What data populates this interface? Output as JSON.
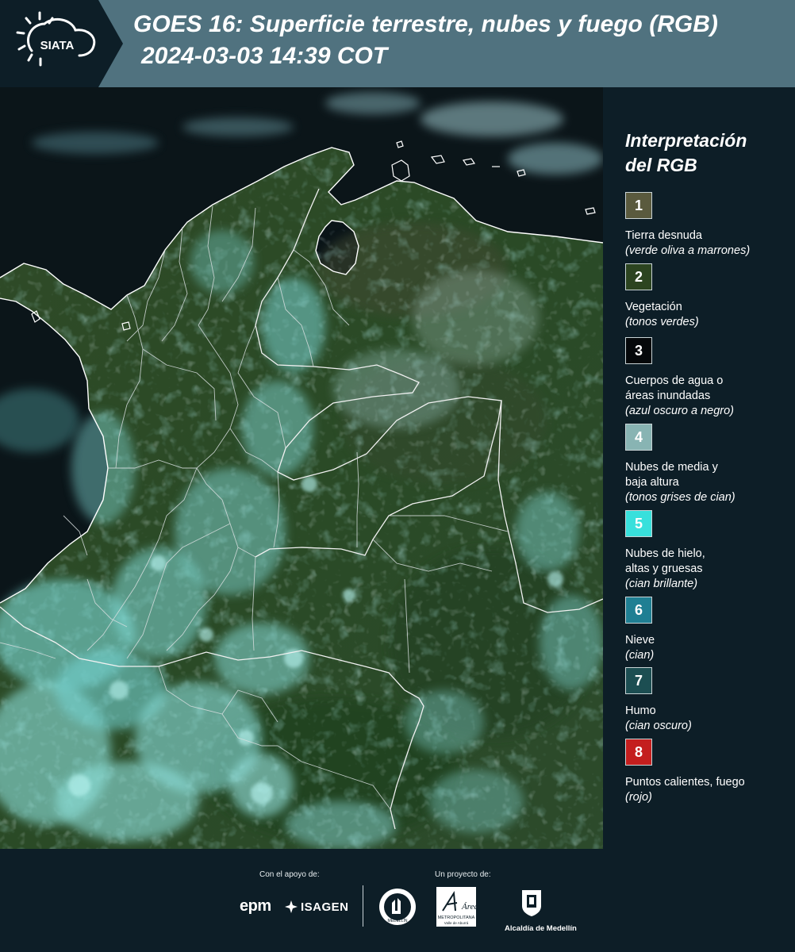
{
  "header": {
    "logo_text": "SIATA",
    "title_line1": "GOES 16: Superficie terrestre, nubes y fuego (RGB)",
    "title_line2": "2024-03-03 14:39 COT"
  },
  "legend": {
    "title_line1": "Interpretación",
    "title_line2": "del RGB",
    "items": [
      {
        "number": "1",
        "color": "#5a5a3e",
        "label": "Tierra desnuda",
        "label2": "",
        "note": "(verde oliva a marrones)"
      },
      {
        "number": "2",
        "color": "#2c4420",
        "label": "Vegetación",
        "label2": "",
        "note": "(tonos verdes)"
      },
      {
        "number": "3",
        "color": "#05080a",
        "label": "Cuerpos de agua o",
        "label2": "áreas inundadas",
        "note": "(azul oscuro a negro)"
      },
      {
        "number": "4",
        "color": "#88b4b3",
        "label": "Nubes de media y",
        "label2": "baja altura",
        "note": "(tonos grises de cian)"
      },
      {
        "number": "5",
        "color": "#38e0dc",
        "label": "Nubes de hielo,",
        "label2": "altas y gruesas",
        "note": "(cian brillante)"
      },
      {
        "number": "6",
        "color": "#1f7f93",
        "label": "Nieve",
        "label2": "",
        "note": "(cian)"
      },
      {
        "number": "7",
        "color": "#1c4e52",
        "label": "Humo",
        "label2": "",
        "note": "(cian oscuro)"
      },
      {
        "number": "8",
        "color": "#c41e1e",
        "label": "Puntos calientes, fuego",
        "label2": "",
        "note": "(rojo)"
      }
    ]
  },
  "footer": {
    "support_label": "Con el apoyo de:",
    "project_label": "Un proyecto de:",
    "epm": "epm",
    "isagen": "ISAGEN",
    "area_name": "Área",
    "area_sub": "METROPOLITANA",
    "area_sub2": "Valle de Aburrá",
    "alcaldia": "Alcaldía de Medellín",
    "seal_label": "MEDELLÍN"
  },
  "colors": {
    "header_bg": "#50727f",
    "logo_panel_bg": "#0d1e27",
    "page_bg": "#0d1e27",
    "ocean": "#0b1519",
    "land": "#2a4424"
  }
}
